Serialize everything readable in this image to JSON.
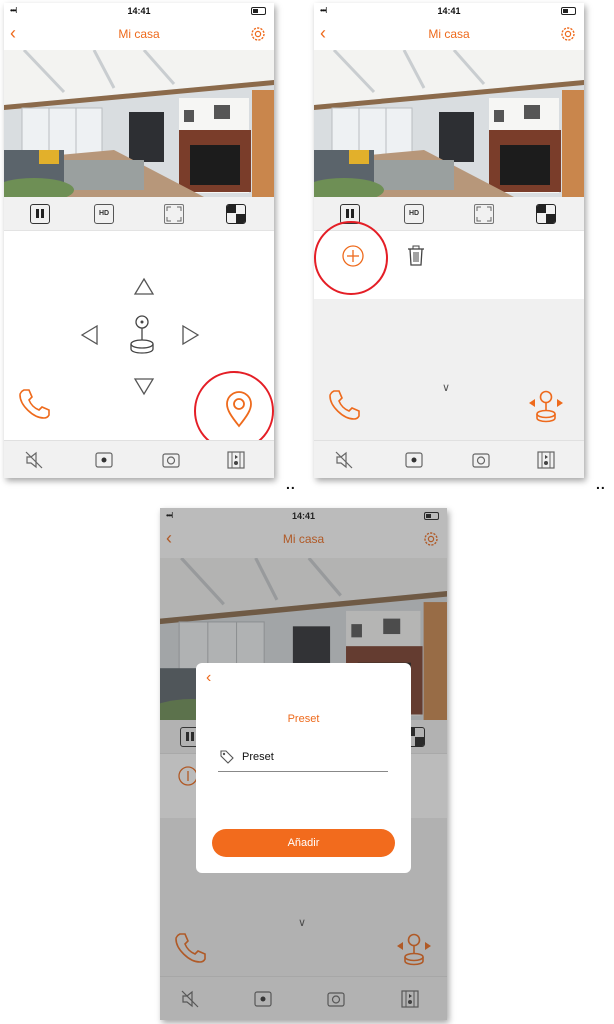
{
  "status": {
    "time": "14:41",
    "signal": "•••l"
  },
  "nav": {
    "title": "Mi casa",
    "back_glyph": "‹"
  },
  "toolbar": {
    "hd_label": "HD"
  },
  "ptz": {
    "up_glyph": "△",
    "down_glyph": "▽",
    "left_glyph": "◁",
    "right_glyph": "▷"
  },
  "preset_panel": {
    "add_glyph": "⊕",
    "collapse_glyph": "∨"
  },
  "dialog": {
    "title": "Preset",
    "input_value": "Preset",
    "submit_label": "Añadir"
  },
  "ellipsis": "..",
  "colors": {
    "accent": "#ee6a1c",
    "highlight": "#e41e26",
    "button": "#f26b1d"
  },
  "icons": [
    "back-icon",
    "gear-icon",
    "pause-icon",
    "hd-icon",
    "fullscreen-icon",
    "split-view-icon",
    "arrow-up-icon",
    "arrow-down-icon",
    "arrow-left-icon",
    "arrow-right-icon",
    "joystick-icon",
    "phone-icon",
    "location-pin-icon",
    "add-icon",
    "trash-icon",
    "mute-icon",
    "record-icon",
    "camera-icon",
    "gallery-icon",
    "tag-icon"
  ]
}
